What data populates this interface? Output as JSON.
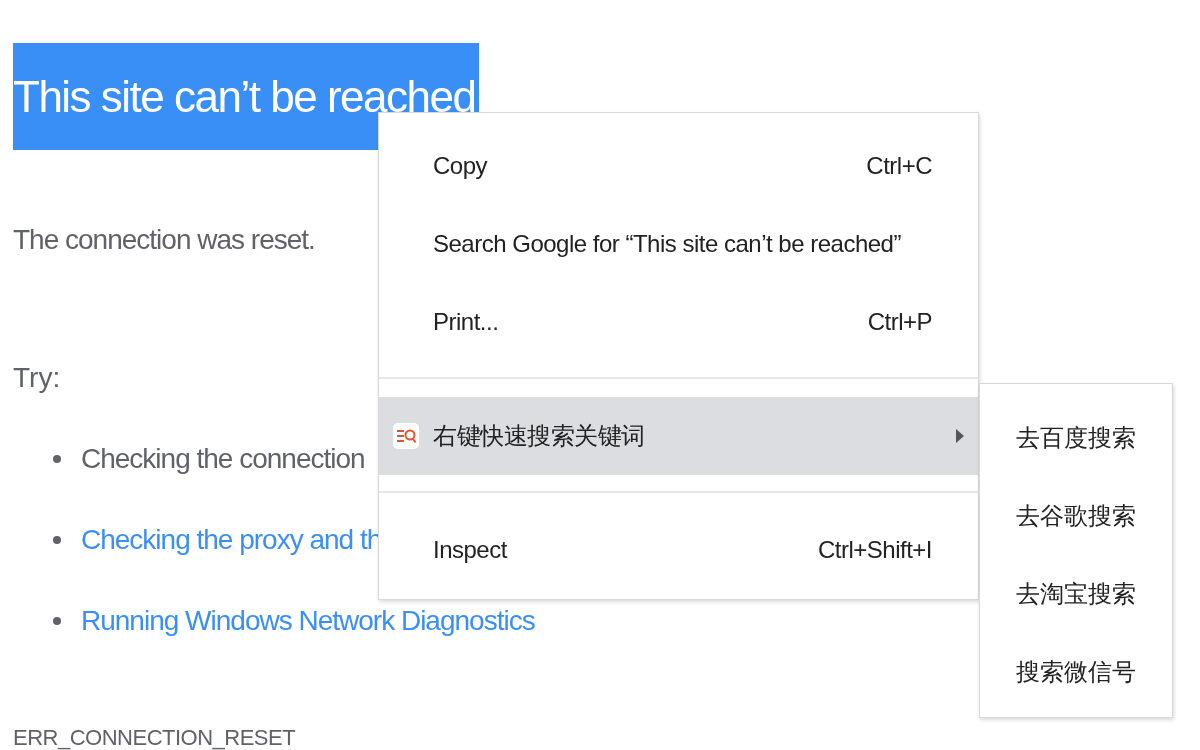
{
  "page": {
    "title": "This site can’t be reached",
    "title_selected": true,
    "message": "The connection was reset.",
    "try_label": "Try:",
    "suggestions": [
      {
        "text": "Checking the connection",
        "kind": "plain"
      },
      {
        "text": "Checking the proxy and th",
        "kind": "link"
      },
      {
        "text": "Running Windows Network Diagnostics",
        "kind": "link"
      }
    ],
    "error_code": "ERR_CONNECTION_RESET"
  },
  "context_menu": {
    "items": [
      {
        "kind": "item",
        "label": "Copy",
        "shortcut": "Ctrl+C",
        "selected": false
      },
      {
        "kind": "item",
        "label": "Search Google for “This site can’t be reached”",
        "selected": false
      },
      {
        "kind": "item",
        "label": "Print...",
        "shortcut": "Ctrl+P",
        "selected": false
      },
      {
        "kind": "separator"
      },
      {
        "kind": "submenu",
        "label": "右键快速搜索关键词",
        "selected": true
      },
      {
        "kind": "separator"
      },
      {
        "kind": "item",
        "label": "Inspect",
        "shortcut": "Ctrl+Shift+I",
        "selected": false
      }
    ],
    "submenu": [
      {
        "label": "去百度搜索"
      },
      {
        "label": "去谷歌搜索"
      },
      {
        "label": "去淘宝搜索"
      },
      {
        "label": "搜索微信号"
      }
    ]
  }
}
